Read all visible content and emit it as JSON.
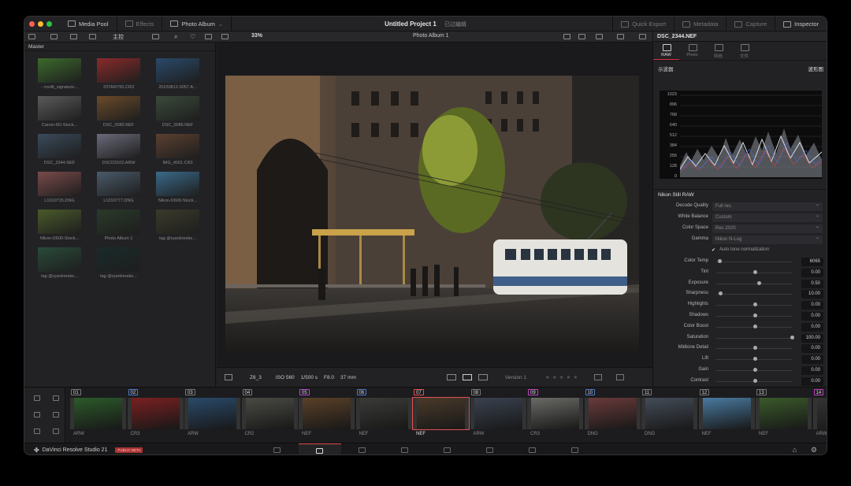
{
  "titlebar": {
    "media_pool": "Media Pool",
    "effects": "Effects",
    "photo_album": "Photo Album",
    "project_title": "Untitled Project 1",
    "project_status": "已过编辑",
    "quick_export": "Quick Export",
    "metadata": "Metadata",
    "capture": "Capture",
    "inspector": "Inspector"
  },
  "toolbar": {
    "bin_label": "主控",
    "zoom": "33%",
    "album_name": "Photo Album 1"
  },
  "media_pool": {
    "header": "Master",
    "items": [
      {
        "label": "- credit_signature..."
      },
      {
        "label": "23TAI0760.CR3"
      },
      {
        "label": "20230812-0057.A..."
      },
      {
        "label": "Canon-6D-Stock..."
      },
      {
        "label": "DSC_0080.NEF"
      },
      {
        "label": "DSC_0086.NEF"
      },
      {
        "label": "DSC_2344.NEF"
      },
      {
        "label": "DSCD3102.ARW"
      },
      {
        "label": "IMG_4001.CR3"
      },
      {
        "label": "L1010715.DNG"
      },
      {
        "label": "L1010777.DNG"
      },
      {
        "label": "Nikon-D600-Stock..."
      },
      {
        "label": "Nikon-D600-Stock..."
      },
      {
        "label": "Photo Album 1"
      },
      {
        "label": "tag @ryanbreeke..."
      },
      {
        "label": "tag @ryanbreeke..."
      },
      {
        "label": "tag @ryanbreeke..."
      }
    ]
  },
  "viewer_footer": {
    "camera": "Z6_3",
    "iso": "ISO 560",
    "shutter": "1/500 s",
    "aperture": "F8.0",
    "focal": "37 mm",
    "version": "Version 1"
  },
  "inspector": {
    "filename": "DSC_2344.NEF",
    "tabs": [
      "RAW",
      "Photo",
      "特效",
      "文件"
    ],
    "scope_label": "示波器",
    "scope_mode": "波形图",
    "scope_ticks": [
      "1023",
      "896",
      "768",
      "640",
      "512",
      "384",
      "256",
      "128",
      "0"
    ],
    "section": "Nikon Still RAW",
    "selects": [
      {
        "label": "Decode Quality",
        "value": "Full res."
      },
      {
        "label": "White Balance",
        "value": "Custom"
      },
      {
        "label": "Color Space",
        "value": "Rec.2020"
      },
      {
        "label": "Gamma",
        "value": "Nikon N-Log"
      }
    ],
    "auto_tone": "Auto tone normalization",
    "sliders": [
      {
        "label": "Color Temp",
        "value": "6065",
        "pos": 0.02
      },
      {
        "label": "Tint",
        "value": "0.00",
        "pos": 0.5
      },
      {
        "label": "Exposure",
        "value": "0.50",
        "pos": 0.55
      },
      {
        "label": "Sharpness",
        "value": "10.00",
        "pos": 0.03
      },
      {
        "label": "Highlights",
        "value": "0.00",
        "pos": 0.5
      },
      {
        "label": "Shadows",
        "value": "0.00",
        "pos": 0.5
      },
      {
        "label": "Color Boost",
        "value": "0.00",
        "pos": 0.5
      },
      {
        "label": "Saturation",
        "value": "100.00",
        "pos": 1.0
      },
      {
        "label": "Midtone Detail",
        "value": "0.00",
        "pos": 0.5
      },
      {
        "label": "Lift",
        "value": "0.00",
        "pos": 0.5
      },
      {
        "label": "Gain",
        "value": "0.00",
        "pos": 0.5
      },
      {
        "label": "Contrast",
        "value": "0.00",
        "pos": 0.5
      }
    ]
  },
  "timeline": {
    "clips": [
      {
        "num": "01",
        "type": "ARW",
        "color": "#777"
      },
      {
        "num": "02",
        "type": "CR3",
        "color": "#4a7bd0"
      },
      {
        "num": "03",
        "type": "ARW",
        "color": "#777"
      },
      {
        "num": "04",
        "type": "CR2",
        "color": "#777"
      },
      {
        "num": "05",
        "type": "NEF",
        "color": "#b04ad0"
      },
      {
        "num": "06",
        "type": "NEF",
        "color": "#4a7bd0"
      },
      {
        "num": "07",
        "type": "NEF",
        "color": "#e05050"
      },
      {
        "num": "08",
        "type": "ARW",
        "color": "#777"
      },
      {
        "num": "09",
        "type": "CR3",
        "color": "#c040c0"
      },
      {
        "num": "10",
        "type": "DNG",
        "color": "#4a7bd0"
      },
      {
        "num": "11",
        "type": "DNG",
        "color": "#777"
      },
      {
        "num": "12",
        "type": "NEF",
        "color": "#777"
      },
      {
        "num": "13",
        "type": "NEF",
        "color": "#777"
      },
      {
        "num": "14",
        "type": "ARW",
        "color": "#c040c0"
      }
    ]
  },
  "bottombar": {
    "app_name": "DaVinci Resolve Studio 21",
    "beta": "PUBLIC BETA"
  }
}
